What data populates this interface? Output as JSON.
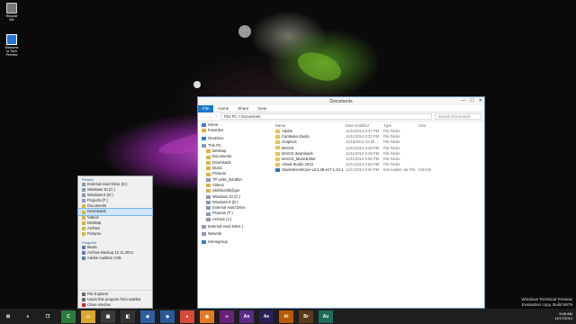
{
  "desktop": {
    "icons": [
      {
        "label": "Recycle Bin",
        "icon": "recycle-bin-icon"
      },
      {
        "label": "Welcome to Tech Preview",
        "icon": "windows-logo-icon"
      }
    ],
    "watermark": [
      "Windows Technical Preview",
      "Evaluation copy. Build 9879"
    ]
  },
  "explorer": {
    "title": "Documents",
    "window_buttons": [
      "—",
      "☐",
      "✕"
    ],
    "ribbon_tabs": [
      "File",
      "Home",
      "Share",
      "View"
    ],
    "address": "This PC > Documents",
    "search_placeholder": "Search Documents",
    "nav": [
      {
        "label": "Home",
        "icon": "home-icon"
      },
      {
        "label": "Favorites",
        "icon": "star-icon"
      },
      {
        "label": "OneDrive",
        "icon": "cloud-icon"
      },
      {
        "label": "This PC",
        "icon": "pc-icon"
      },
      {
        "label": "Desktop",
        "icon": "folder-icon"
      },
      {
        "label": "Documents",
        "icon": "folder-icon"
      },
      {
        "label": "Downloads",
        "icon": "folder-icon"
      },
      {
        "label": "Music",
        "icon": "folder-icon"
      },
      {
        "label": "Pictures",
        "icon": "folder-icon"
      },
      {
        "label": "TP-LINK_B4485A",
        "icon": "network-drive-icon"
      },
      {
        "label": "Videos",
        "icon": "folder-icon"
      },
      {
        "label": "whitbrushb@gm",
        "icon": "folder-icon"
      },
      {
        "label": "Windows 10 (C:)",
        "icon": "drive-icon"
      },
      {
        "label": "Windows 8 (D:)",
        "icon": "drive-icon"
      },
      {
        "label": "External Hard Drive",
        "icon": "drive-icon"
      },
      {
        "label": "Projects (F:)",
        "icon": "drive-icon"
      },
      {
        "label": "Archive (J:)",
        "icon": "drive-icon"
      },
      {
        "label": "External Hard Drive (",
        "icon": "drive-icon"
      },
      {
        "label": "Network",
        "icon": "network-icon"
      },
      {
        "label": "Homegroup",
        "icon": "homegroup-icon"
      }
    ],
    "columns": [
      "Name",
      "Date modified",
      "Type",
      "Size"
    ],
    "files": [
      {
        "name": "Adobe",
        "date": "11/11/2014 5:37 PM",
        "type": "File folder",
        "size": "",
        "icon": "folder-icon"
      },
      {
        "name": "Camtasia Studio",
        "date": "11/11/2014 5:31 PM",
        "type": "File folder",
        "size": "",
        "icon": "folder-icon"
      },
      {
        "name": "Graphics",
        "date": "11/16/2014 10:25 ...",
        "type": "File folder",
        "size": "",
        "icon": "folder-icon"
      },
      {
        "name": "MAGIX",
        "date": "11/11/2014 5:49 PM",
        "type": "File folder",
        "size": "",
        "icon": "folder-icon"
      },
      {
        "name": "MAGIX downloads",
        "date": "11/11/2014 5:49 PM",
        "type": "File folder",
        "size": "",
        "icon": "folder-icon"
      },
      {
        "name": "MAGIX_MusicEditor",
        "date": "11/11/2014 5:56 PM",
        "type": "File folder",
        "size": "",
        "icon": "folder-icon"
      },
      {
        "name": "Visual Studio 2013",
        "date": "11/11/2014 5:56 PM",
        "type": "File folder",
        "size": "",
        "icon": "folder-icon"
      },
      {
        "name": "StudentHostCore-v2.3.28-en7.1.10.4",
        "date": "11/11/2014 6:00 PM",
        "type": "Executable Jar File",
        "size": "240 KB",
        "icon": "jar-file-icon"
      }
    ]
  },
  "jumplist": {
    "pinned_label": "Pinned",
    "pinned": [
      "External Hard Drive (E:)",
      "Windows 10 (C:)",
      "Windows 8 (D:)",
      "Projects (F:)",
      "Documents",
      "Downloads",
      "Videos",
      "Desktop",
      "Archive",
      "Pictures"
    ],
    "frequent_label": "Frequent",
    "frequent": [
      "Music",
      "Archive Backup 12.11.2014",
      "Adobe Audition CS6"
    ],
    "footer": [
      "File Explorer",
      "Unpin this program from taskbar",
      "Close window"
    ]
  },
  "taskbar": {
    "apps": [
      {
        "name": "start",
        "icon": "windows-start-icon",
        "glyph": "⊞",
        "color": "#1e1e1e"
      },
      {
        "name": "search",
        "icon": "search-icon",
        "glyph": "⌕",
        "color": "#1e1e1e"
      },
      {
        "name": "task-view",
        "icon": "task-view-icon",
        "glyph": "❐",
        "color": "#1e1e1e"
      },
      {
        "name": "camtasia",
        "icon": "camtasia-icon",
        "glyph": "C",
        "color": "#2b7a3d"
      },
      {
        "name": "file-explorer",
        "icon": "folder-icon",
        "glyph": "▭",
        "color": "#d9a62e"
      },
      {
        "name": "store",
        "icon": "store-icon",
        "glyph": "▣",
        "color": "#3a3a3a"
      },
      {
        "name": "magix",
        "icon": "magix-icon",
        "glyph": "◧",
        "color": "#333"
      },
      {
        "name": "virtualbox",
        "icon": "virtualbox-icon",
        "glyph": "◈",
        "color": "#2c5f9e"
      },
      {
        "name": "netbeans",
        "icon": "netbeans-icon",
        "glyph": "◆",
        "color": "#2a5a9a"
      },
      {
        "name": "chrome",
        "icon": "chrome-icon",
        "glyph": "●",
        "color": "#d94a38"
      },
      {
        "name": "firefox",
        "icon": "firefox-icon",
        "glyph": "◉",
        "color": "#e07b23"
      },
      {
        "name": "visual-studio",
        "icon": "visual-studio-icon",
        "glyph": "∞",
        "color": "#68217a"
      },
      {
        "name": "animate",
        "icon": "animate-icon",
        "glyph": "An",
        "color": "#5b2a86"
      },
      {
        "name": "after-effects",
        "icon": "after-effects-icon",
        "glyph": "Ae",
        "color": "#2b1e5a"
      },
      {
        "name": "illustrator",
        "icon": "illustrator-icon",
        "glyph": "Ai",
        "color": "#b85a00"
      },
      {
        "name": "bridge",
        "icon": "bridge-icon",
        "glyph": "Br",
        "color": "#5a3a1a"
      },
      {
        "name": "audition",
        "icon": "audition-icon",
        "glyph": "Au",
        "color": "#1d6b5a"
      }
    ],
    "time": "5:08 AM",
    "date": "11/17/2014"
  }
}
